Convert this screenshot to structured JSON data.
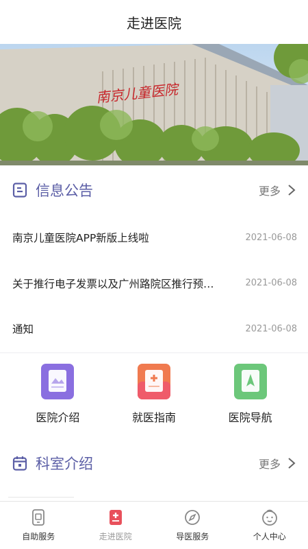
{
  "header": {
    "title": "走进医院"
  },
  "banner": {
    "sign_text": "南京儿童医院"
  },
  "notice": {
    "title": "信息公告",
    "more_label": "更多",
    "items": [
      {
        "text": "南京儿童医院APP新版上线啦",
        "date": "2021-06-08"
      },
      {
        "text": "关于推行电子发票以及广州路院区推行预…",
        "date": "2021-06-08"
      },
      {
        "text": "通知",
        "date": "2021-06-08"
      }
    ]
  },
  "quick_links": [
    {
      "label": "医院介绍",
      "icon": "hospital-intro-icon",
      "color": "#8a6fe0"
    },
    {
      "label": "就医指南",
      "icon": "medical-guide-icon",
      "color": "#f07a4f"
    },
    {
      "label": "医院导航",
      "icon": "hospital-navigation-icon",
      "color": "#6cc77a"
    }
  ],
  "departments": {
    "title": "科室介绍",
    "more_label": "更多"
  },
  "tabbar": {
    "items": [
      {
        "label": "自助服务",
        "icon": "self-service-icon",
        "active": false
      },
      {
        "label": "走进医院",
        "icon": "hospital-icon",
        "active": true
      },
      {
        "label": "导医服务",
        "icon": "compass-icon",
        "active": false
      },
      {
        "label": "个人中心",
        "icon": "user-face-icon",
        "active": false
      }
    ]
  },
  "colors": {
    "accent": "#5b5ea6",
    "active_tab": "#e8505b"
  }
}
